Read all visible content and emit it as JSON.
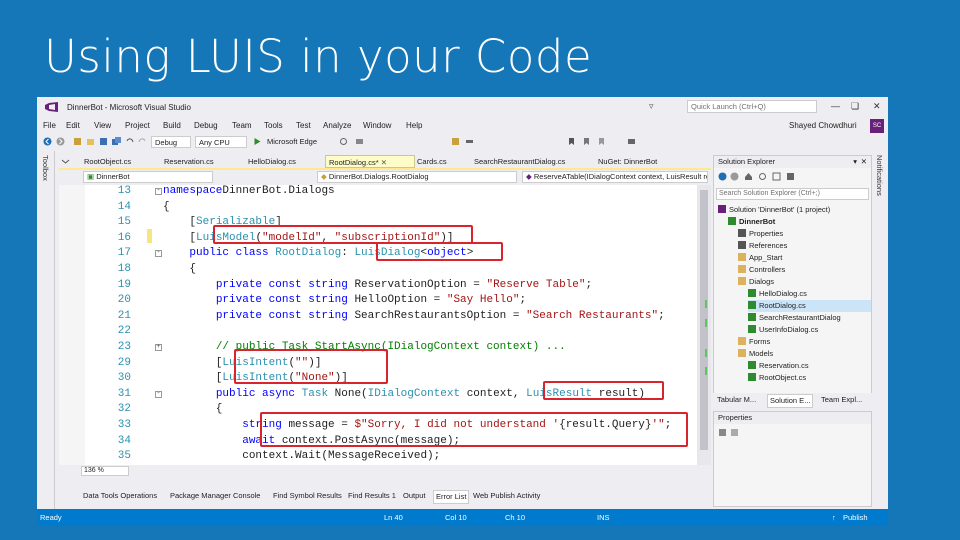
{
  "slide": {
    "title": "Using LUIS in your Code"
  },
  "window": {
    "title": "DinnerBot - Microsoft Visual Studio",
    "quick_launch": "Quick Launch (Ctrl+Q)",
    "user": "Shayed Chowdhuri",
    "avatar": "SC",
    "icons": [
      "vs-logo-icon",
      "filter-icon",
      "minimize-icon",
      "maximize-icon",
      "close-icon"
    ]
  },
  "menu": [
    "File",
    "Edit",
    "View",
    "Project",
    "Build",
    "Debug",
    "Team",
    "Tools",
    "Test",
    "Analyze",
    "Window",
    "Help"
  ],
  "toolbar": {
    "config": "Debug",
    "platform": "Any CPU",
    "run_target": "Microsoft Edge"
  },
  "side_strips": {
    "left": "Toolbox",
    "right": "Notifications"
  },
  "tabs": [
    {
      "label": "RootObject.cs",
      "active": false
    },
    {
      "label": "Reservation.cs",
      "active": false
    },
    {
      "label": "HelloDialog.cs",
      "active": false
    },
    {
      "label": "RootDialog.cs*",
      "active": true
    },
    {
      "label": "Cards.cs",
      "active": false
    },
    {
      "label": "SearchRestaurantDialog.cs",
      "active": false
    },
    {
      "label": "NuGet: DinnerBot",
      "active": false
    }
  ],
  "navbar": {
    "project": "DinnerBot",
    "class": "DinnerBot.Dialogs.RootDialog",
    "member": "ReserveATable(IDialogContext context, LuisResult res"
  },
  "code": [
    {
      "n": "13",
      "t": [
        [
          "kw",
          "namespace"
        ],
        [
          "",
          "DinnerBot.Dialogs"
        ]
      ]
    },
    {
      "n": "14",
      "t": [
        [
          "",
          "{"
        ]
      ]
    },
    {
      "n": "15",
      "t": [
        [
          "",
          "    ["
        ],
        [
          "ty",
          "Serializable"
        ],
        [
          "",
          "]"
        ]
      ]
    },
    {
      "n": "16",
      "t": [
        [
          "",
          "    ["
        ],
        [
          "ty",
          "LuisModel"
        ],
        [
          "",
          "("
        ],
        [
          "st",
          "\"modelId\""
        ],
        [
          "",
          ", "
        ],
        [
          "st",
          "\"subscriptionId\""
        ],
        [
          "",
          ")]"
        ]
      ]
    },
    {
      "n": "17",
      "t": [
        [
          "",
          "    "
        ],
        [
          "kw",
          "public class "
        ],
        [
          "ty",
          "RootDialog"
        ],
        [
          "",
          ": "
        ],
        [
          "ty",
          "LuisDialog"
        ],
        [
          "",
          "<"
        ],
        [
          "kw",
          "object"
        ],
        [
          "",
          ">"
        ]
      ]
    },
    {
      "n": "18",
      "t": [
        [
          "",
          "    {"
        ]
      ]
    },
    {
      "n": "19",
      "t": [
        [
          "",
          "        "
        ],
        [
          "kw",
          "private const string "
        ],
        [
          "",
          "ReservationOption = "
        ],
        [
          "st",
          "\"Reserve Table\""
        ],
        [
          "",
          ";"
        ]
      ]
    },
    {
      "n": "20",
      "t": [
        [
          "",
          "        "
        ],
        [
          "kw",
          "private const string "
        ],
        [
          "",
          "HelloOption = "
        ],
        [
          "st",
          "\"Say Hello\""
        ],
        [
          "",
          ";"
        ]
      ]
    },
    {
      "n": "21",
      "t": [
        [
          "",
          "        "
        ],
        [
          "kw",
          "private const string "
        ],
        [
          "",
          "SearchRestaurantsOption = "
        ],
        [
          "st",
          "\"Search Restaurants\""
        ],
        [
          "",
          ";"
        ]
      ]
    },
    {
      "n": "22",
      "t": [
        [
          "",
          ""
        ]
      ]
    },
    {
      "n": "23",
      "t": [
        [
          "",
          "        "
        ],
        [
          "cm",
          "// public Task StartAsync(IDialogContext context) ..."
        ]
      ]
    },
    {
      "n": "29",
      "t": [
        [
          "",
          "        ["
        ],
        [
          "ty",
          "LuisIntent"
        ],
        [
          "",
          "("
        ],
        [
          "st",
          "\"\""
        ],
        [
          "",
          ")]"
        ]
      ]
    },
    {
      "n": "30",
      "t": [
        [
          "",
          "        ["
        ],
        [
          "ty",
          "LuisIntent"
        ],
        [
          "",
          "("
        ],
        [
          "st",
          "\"None\""
        ],
        [
          "",
          ")]"
        ]
      ]
    },
    {
      "n": "31",
      "t": [
        [
          "",
          "        "
        ],
        [
          "kw",
          "public async "
        ],
        [
          "ty",
          "Task "
        ],
        [
          "",
          "None("
        ],
        [
          "ty",
          "IDialogContext "
        ],
        [
          "",
          "context, "
        ],
        [
          "ty",
          "LuisResult "
        ],
        [
          "",
          "result)"
        ]
      ]
    },
    {
      "n": "32",
      "t": [
        [
          "",
          "        {"
        ]
      ]
    },
    {
      "n": "33",
      "t": [
        [
          "",
          "            "
        ],
        [
          "kw",
          "string "
        ],
        [
          "",
          "message = "
        ],
        [
          "st",
          "$\"Sorry, I did not understand '"
        ],
        [
          "",
          "{result.Query}"
        ],
        [
          "st",
          "'\""
        ],
        [
          "",
          ";"
        ]
      ]
    },
    {
      "n": "34",
      "t": [
        [
          "",
          "            "
        ],
        [
          "kw",
          "await "
        ],
        [
          "",
          "context.PostAsync(message);"
        ]
      ]
    },
    {
      "n": "35",
      "t": [
        [
          "",
          "            context.Wait(MessageReceived);"
        ]
      ]
    },
    {
      "n": "36",
      "t": [
        [
          "",
          "        }"
        ]
      ]
    }
  ],
  "zoom": "136 %",
  "solution_explorer": {
    "title": "Solution Explorer",
    "search": "Search Solution Explorer (Ctrl+;)",
    "tree": [
      {
        "label": "Solution 'DinnerBot' (1 project)",
        "depth": 0,
        "icon": "solution-icon"
      },
      {
        "label": "DinnerBot",
        "depth": 1,
        "icon": "project-icon",
        "bold": true
      },
      {
        "label": "Properties",
        "depth": 2,
        "icon": "wrench-icon"
      },
      {
        "label": "References",
        "depth": 2,
        "icon": "references-icon"
      },
      {
        "label": "App_Start",
        "depth": 2,
        "icon": "folder-icon"
      },
      {
        "label": "Controllers",
        "depth": 2,
        "icon": "folder-icon"
      },
      {
        "label": "Dialogs",
        "depth": 2,
        "icon": "folder-icon"
      },
      {
        "label": "HelloDialog.cs",
        "depth": 3,
        "icon": "csharp-file-icon"
      },
      {
        "label": "RootDialog.cs",
        "depth": 3,
        "icon": "csharp-file-icon",
        "selected": true
      },
      {
        "label": "SearchRestaurantDialog",
        "depth": 3,
        "icon": "csharp-file-icon"
      },
      {
        "label": "UserInfoDialog.cs",
        "depth": 3,
        "icon": "csharp-file-icon"
      },
      {
        "label": "Forms",
        "depth": 2,
        "icon": "folder-icon"
      },
      {
        "label": "Models",
        "depth": 2,
        "icon": "folder-icon"
      },
      {
        "label": "Reservation.cs",
        "depth": 3,
        "icon": "csharp-file-icon"
      },
      {
        "label": "RootObject.cs",
        "depth": 3,
        "icon": "csharp-file-icon"
      }
    ],
    "tabs": [
      "Tabular M...",
      "Solution E...",
      "Team Expl..."
    ]
  },
  "properties": {
    "title": "Properties"
  },
  "bottom_tabs": [
    "Data Tools Operations",
    "Package Manager Console",
    "Find Symbol Results",
    "Find Results 1",
    "Output",
    "Error List",
    "Web Publish Activity"
  ],
  "status": {
    "state": "Ready",
    "ln": "Ln 40",
    "col": "Col 10",
    "ch": "Ch 10",
    "mode": "INS",
    "publish": "Publish"
  },
  "colors": {
    "slide_bg": "#1677b8",
    "status_bar": "#007acc",
    "highlight": "#d9232d"
  }
}
